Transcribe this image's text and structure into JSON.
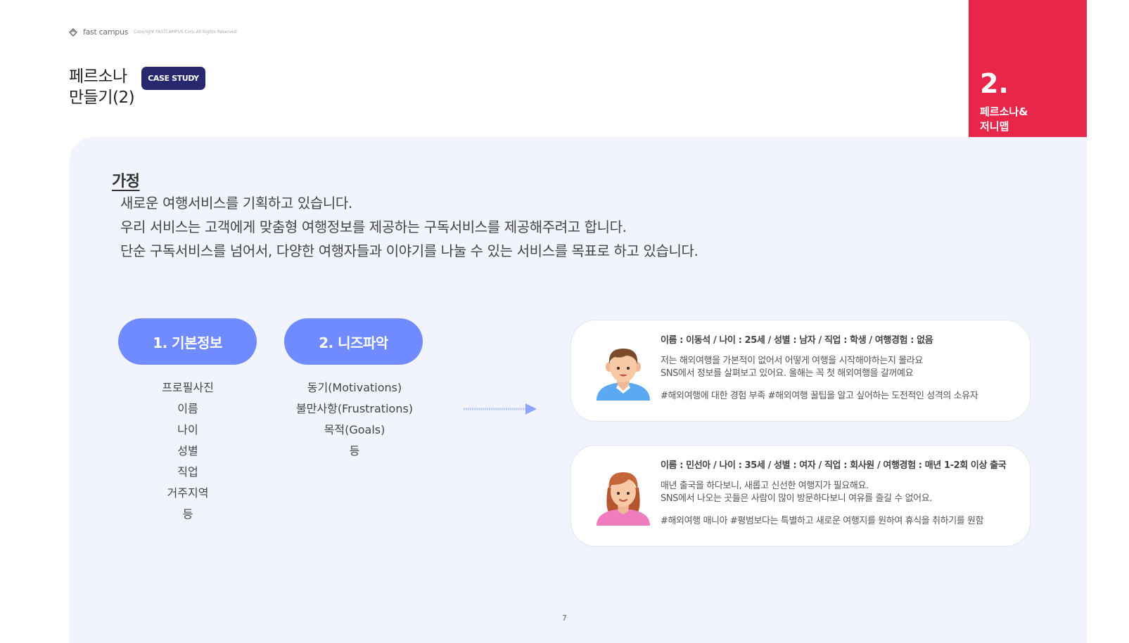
{
  "header": {
    "logo_text": "fast campus",
    "copyright": "Copyright FASTCAMPUS Corp.All Rights Reserved",
    "title_line1": "페르소나",
    "title_line2": "만들기(2)",
    "badge": "CASE STUDY"
  },
  "section": {
    "number": "2.",
    "label_line1": "페르소나&",
    "label_line2": "저니맵",
    "color": "#e8264a"
  },
  "hypothesis": {
    "title": "가정",
    "lines": [
      "새로운 여행서비스를 기획하고 있습니다.",
      "우리 서비스는 고객에게 맞춤형 여행정보를 제공하는 구독서비스를 제공해주려고 합니다.",
      "단순 구독서비스를 넘어서, 다양한 여행자들과 이야기를 나눌 수 있는 서비스를 목표로 하고 있습니다."
    ]
  },
  "steps": [
    {
      "label": "1. 기본정보",
      "items": [
        "프로필사진",
        "이름",
        "나이",
        "성별",
        "직업",
        "거주지역",
        "등"
      ]
    },
    {
      "label": "2. 니즈파악",
      "items": [
        "동기(Motivations)",
        "불만사항(Frustrations)",
        "목적(Goals)",
        "등"
      ]
    }
  ],
  "personas": [
    {
      "avatar": "boy-avatar-icon",
      "header": "이름 : 이동석 / 나이 : 25세 / 성별 : 남자 / 직업 : 학생 / 여행경험 : 없음",
      "body_line1": "저는 해외여행을 가본적이 없어서 어떻게 여행을 시작해야하는지 몰라요",
      "body_line2": "SNS에서 정보를 살펴보고 있어요. 올해는 꼭 첫 해외여행을 갈꺼예요",
      "tags": "#해외여행에 대한 경험 부족 #해외여행 꿀팁을 알고 싶어하는 도전적인 성격의 소유자"
    },
    {
      "avatar": "girl-avatar-icon",
      "header": "이름 : 민선아 / 나이 : 35세 / 성별 : 여자 / 직업 : 회사원 / 여행경험 : 매년 1-2회 이상 출국",
      "body_line1": "매년 출국을 하다보니, 새롭고 신선한 여행지가 필요해요.",
      "body_line2": "SNS에서 나오는 곳들은 사람이 많이 방문하다보니 여유를 즐길 수 없어요.",
      "tags": "#해외여행 매니아 #평범보다는 특별하고 새로운 여행지를 원하여 휴식을 취하기를 원함"
    }
  ],
  "footer": {
    "page_number": "7"
  },
  "colors": {
    "accent": "#6f8bff",
    "badge": "#28286e",
    "panel": "#f1f4fd",
    "ribbon": "#e8264a"
  }
}
